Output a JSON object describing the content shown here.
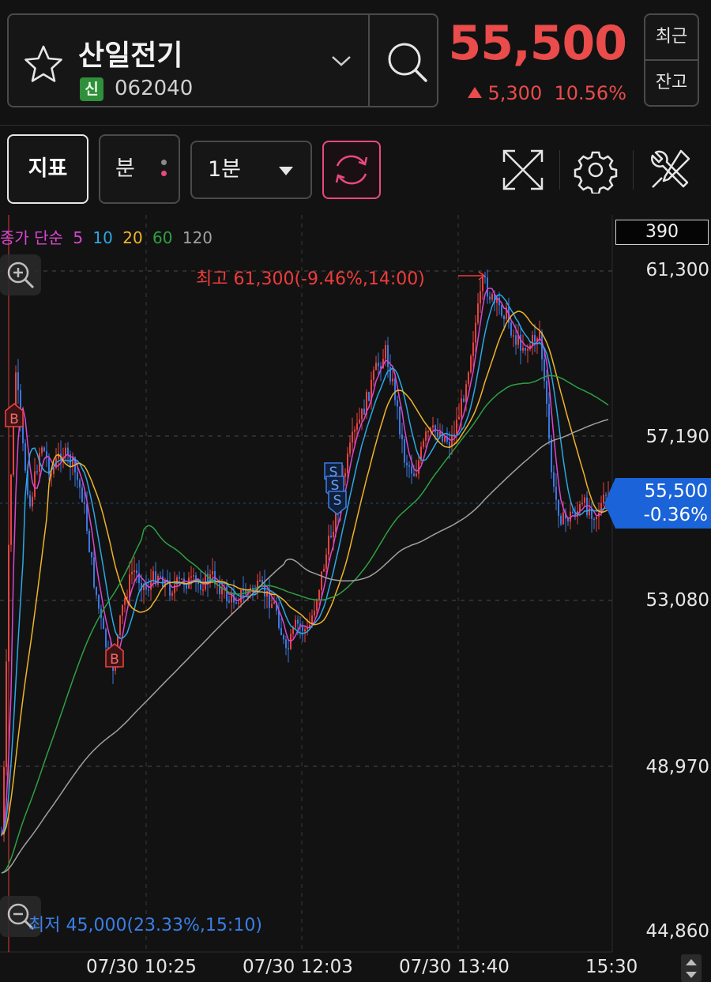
{
  "header": {
    "stock_name": "산일전기",
    "market_badge": "신",
    "stock_code": "062040",
    "price": "55,500",
    "change_amount": "5,300",
    "change_rate": "10.56%",
    "btn_recent": "최근",
    "btn_balance": "잔고",
    "up_color": "#ea4b4b"
  },
  "toolbar": {
    "indicator_label": "지표",
    "minute_label": "분",
    "interval_value": "1분",
    "icons": [
      "star-icon",
      "chevron-down-icon",
      "search-icon",
      "refresh-icon",
      "fullscreen-icon",
      "gear-icon",
      "tools-icon"
    ]
  },
  "legend": {
    "prefix": "종가 단순",
    "ma": [
      {
        "period": "5",
        "color": "#d946d0"
      },
      {
        "period": "10",
        "color": "#2aa8e6"
      },
      {
        "period": "20",
        "color": "#f0b429"
      },
      {
        "period": "60",
        "color": "#2ea043"
      },
      {
        "period": "120",
        "color": "#a0a0a0"
      }
    ]
  },
  "volume_box": "390",
  "y_axis": [
    "61,300",
    "57,190",
    "53,080",
    "48,970",
    "44,860"
  ],
  "x_axis": [
    "07/30 10:25",
    "07/30 12:03",
    "07/30 13:40",
    "15:30"
  ],
  "current_tag": {
    "price": "55,500",
    "change": "-0.36%"
  },
  "annotations": {
    "high": "최고 61,300(-9.46%,14:00)",
    "low": "최저 45,000(23.33%,15:10)",
    "buy_mark": "B",
    "sell_mark": "S"
  }
}
